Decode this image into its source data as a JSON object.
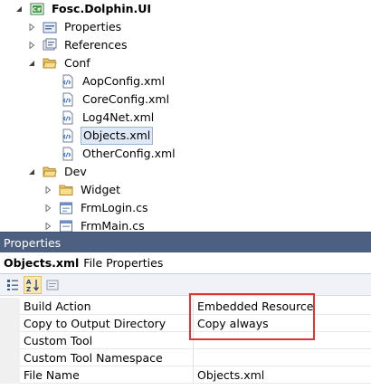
{
  "tree": {
    "project": {
      "label": "Fosc.Dolphin.UI"
    },
    "items": [
      {
        "label": "Properties",
        "icon": "properties-folder-icon"
      },
      {
        "label": "References",
        "icon": "references-icon"
      },
      {
        "label": "Conf",
        "icon": "folder-open-icon"
      },
      {
        "label": "AopConfig.xml",
        "icon": "xml-file-icon"
      },
      {
        "label": "CoreConfig.xml",
        "icon": "xml-file-icon"
      },
      {
        "label": "Log4Net.xml",
        "icon": "xml-file-icon"
      },
      {
        "label": "Objects.xml",
        "icon": "xml-file-icon",
        "selected": true
      },
      {
        "label": "OtherConfig.xml",
        "icon": "xml-file-icon"
      },
      {
        "label": "Dev",
        "icon": "folder-open-icon"
      },
      {
        "label": "Widget",
        "icon": "folder-icon"
      },
      {
        "label": "FrmLogin.cs",
        "icon": "form-file-icon"
      },
      {
        "label": "FrmMain.cs",
        "icon": "form-file-icon"
      }
    ]
  },
  "properties": {
    "title": "Properties",
    "object_name": "Objects.xml",
    "object_type": "File Properties",
    "rows": [
      {
        "name": "Build Action",
        "value": "Embedded Resource"
      },
      {
        "name": "Copy to Output Directory",
        "value": "Copy always"
      },
      {
        "name": "Custom Tool",
        "value": ""
      },
      {
        "name": "Custom Tool Namespace",
        "value": ""
      },
      {
        "name": "File Name",
        "value": "Objects.xml"
      }
    ]
  },
  "colors": {
    "title_bar": "#4d6082",
    "selection": "#dfe8f6",
    "highlight_box": "#e53232"
  }
}
